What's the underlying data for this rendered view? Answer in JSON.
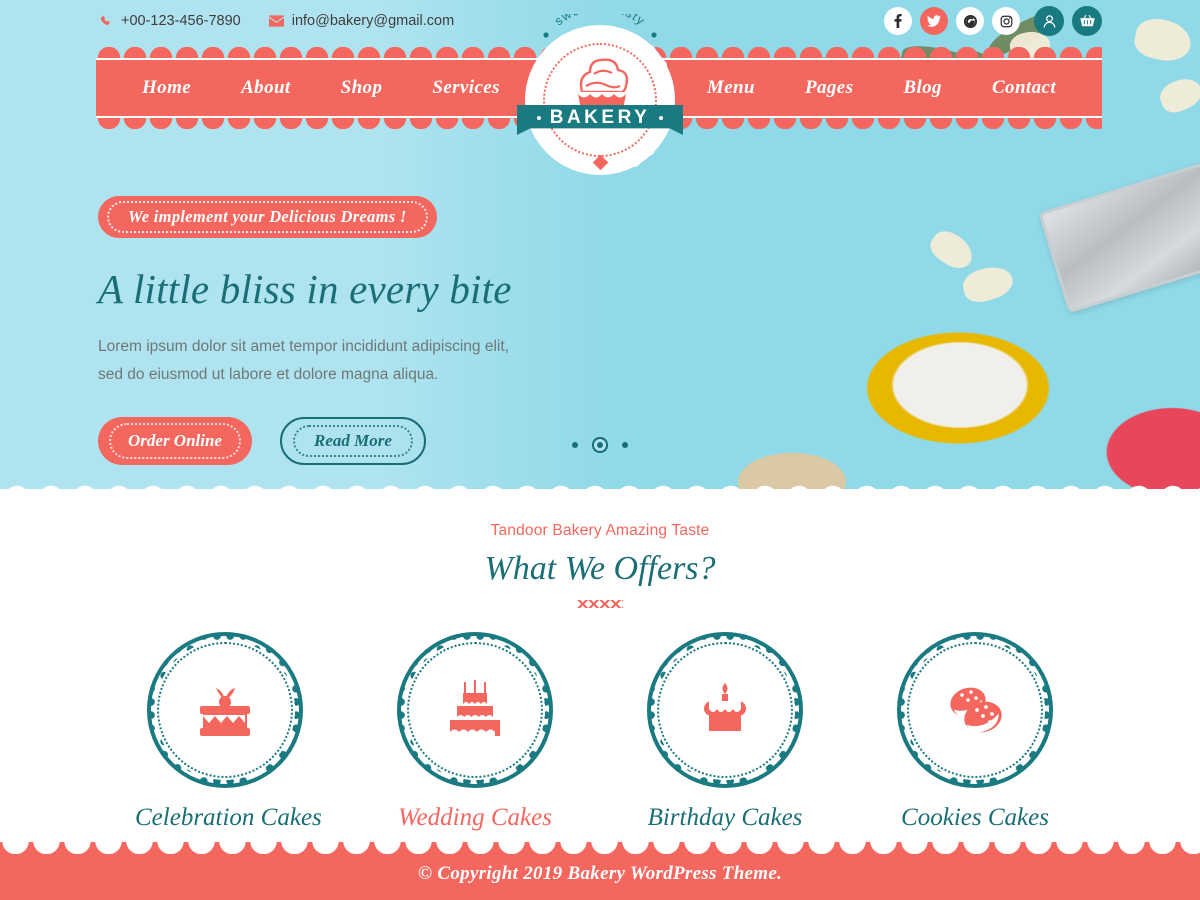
{
  "topbar": {
    "phone": "+00-123-456-7890",
    "email": "info@bakery@gmail.com",
    "phone_icon": "phone-icon",
    "email_icon": "envelope-icon",
    "social": [
      {
        "name": "facebook",
        "glyph": "f",
        "style": "light"
      },
      {
        "name": "twitter",
        "glyph": "t",
        "style": "red"
      },
      {
        "name": "google",
        "glyph": "G",
        "style": "light"
      },
      {
        "name": "instagram",
        "glyph": "o",
        "style": "light"
      }
    ],
    "account_icon": "user-icon",
    "cart_icon": "basket-icon"
  },
  "nav": {
    "left_items": [
      {
        "label": "Home"
      },
      {
        "label": "About"
      },
      {
        "label": "Shop"
      },
      {
        "label": "Services"
      }
    ],
    "right_items": [
      {
        "label": "Menu"
      },
      {
        "label": "Pages"
      },
      {
        "label": "Blog"
      },
      {
        "label": "Contact"
      }
    ]
  },
  "logo": {
    "tagline": "sweet & tasty",
    "name": "BAKERY",
    "icon": "cupcake-icon"
  },
  "hero": {
    "badge": "We implement your Delicious Dreams !",
    "title": "A little bliss in every bite",
    "subtitle_line1": "Lorem ipsum dolor sit amet tempor incididunt adipiscing elit,",
    "subtitle_line2": "sed do eiusmod ut labore et dolore magna aliqua.",
    "primary_button": "Order Online",
    "secondary_button": "Read More",
    "slides": 3,
    "active_slide": 2
  },
  "offers": {
    "eyebrow": "Tandoor Bakery Amazing Taste",
    "heading": "What We Offers?",
    "cards": [
      {
        "title": "Celebration Cakes",
        "icon": "layer-cake-icon",
        "highlighted": false
      },
      {
        "title": "Wedding Cakes",
        "icon": "tiered-wedding-cake-icon",
        "highlighted": true
      },
      {
        "title": "Birthday Cakes",
        "icon": "birthday-cake-candle-icon",
        "highlighted": false
      },
      {
        "title": "Cookies Cakes",
        "icon": "cookies-icon",
        "highlighted": false
      }
    ]
  },
  "footer": {
    "copyright": "© Copyright 2019 Bakery WordPress Theme."
  },
  "colors": {
    "coral": "#f4675e",
    "teal": "#1a7a82",
    "teal_text": "#1a6e76",
    "sky": "#aee3ef",
    "white": "#ffffff"
  }
}
